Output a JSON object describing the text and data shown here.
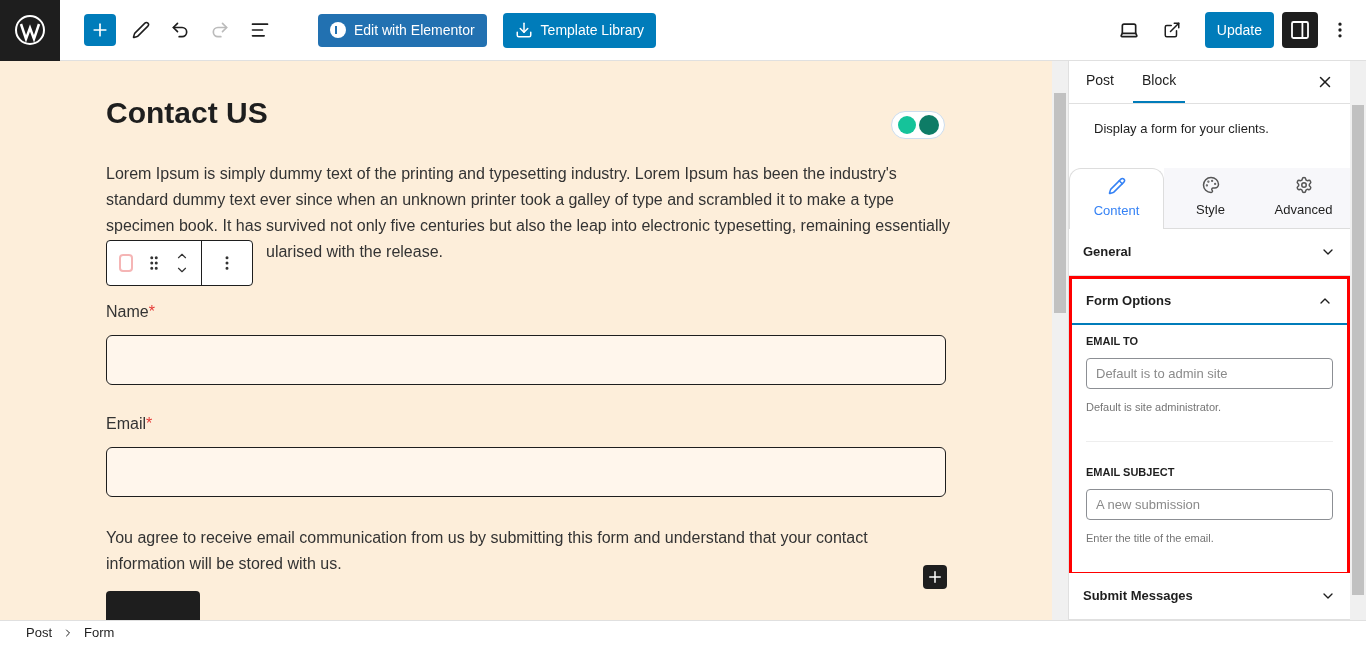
{
  "toolbar": {
    "buttons": [
      {
        "label": "Edit with Elementor",
        "kind": "elementor"
      },
      {
        "label": "Template Library",
        "kind": "library"
      }
    ],
    "update": "Update",
    "settings_open": true
  },
  "document": {
    "title": "Contact US",
    "paragraph_lines": [
      "Lorem Ipsum is simply dummy text of the printing and typesetting industry. Lorem Ipsum has been the industry's",
      "standard dummy text ever since when an unknown printer took a galley of type and scrambled it to make a type",
      "specimen book. It has survived not only five centuries but also the leap into electronic typesetting, remaining essentially"
    ],
    "paragraph_tail": "ularised with the release.",
    "fields": [
      {
        "label": "Name",
        "required_mark": "*"
      },
      {
        "label": "Email",
        "required_mark": "*"
      }
    ],
    "consent_lines": [
      "You agree to receive email communication from us by submitting this form and understand that your contact",
      "information will be stored with us."
    ]
  },
  "sidebar": {
    "tabs": [
      {
        "label": "Post",
        "selected": false
      },
      {
        "label": "Block",
        "selected": true
      }
    ],
    "block_description": "Display a form for your clients.",
    "panel_tabs": [
      {
        "label": "Content",
        "selected": true,
        "kind": "pencil"
      },
      {
        "label": "Style",
        "selected": false,
        "kind": "palette"
      },
      {
        "label": "Advanced",
        "selected": false,
        "kind": "gear"
      }
    ],
    "sections": [
      {
        "title": "General",
        "expanded": false,
        "highlighted": false
      },
      {
        "title": "Form Options",
        "expanded": true,
        "highlighted": true,
        "fields": [
          {
            "label": "EMAIL TO",
            "placeholder": "Default is to admin site",
            "help": "Default is site administrator."
          },
          {
            "label": "EMAIL SUBJECT",
            "placeholder": "A new submission",
            "help": "Enter the title of the email."
          }
        ]
      },
      {
        "title": "Submit Messages",
        "expanded": false,
        "highlighted": false
      }
    ]
  },
  "breadcrumb": [
    "Post",
    "Form"
  ]
}
